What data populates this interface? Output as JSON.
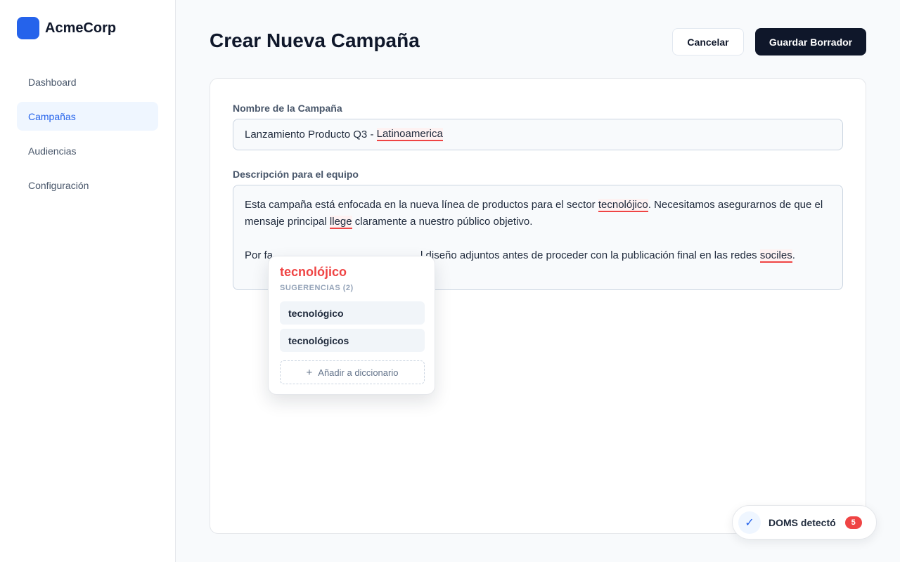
{
  "brand": {
    "name": "AcmeCorp"
  },
  "colors": {
    "accent": "#2563eb",
    "primary_dark": "#0f172a",
    "error": "#ef4444"
  },
  "nav": {
    "items": [
      {
        "label": "Dashboard",
        "active": false
      },
      {
        "label": "Campañas",
        "active": true
      },
      {
        "label": "Audiencias",
        "active": false
      },
      {
        "label": "Configuración",
        "active": false
      }
    ]
  },
  "header": {
    "title": "Crear Nueva Campaña",
    "cancel_label": "Cancelar",
    "save_label": "Guardar Borrador"
  },
  "form": {
    "name_label": "Nombre de la Campaña",
    "name_value_prefix": "Lanzamiento Producto Q3 - ",
    "name_value_error": "Latinoamerica",
    "desc_label": "Descripción para el equipo",
    "desc_p1": {
      "t1": "Esta campaña está enfocada en la nueva línea de productos para el sector ",
      "e1": "tecnolójico",
      "t2": ". Necesitamos asegurarnos de que el mensaje principal ",
      "e2": "llege",
      "t3": " claramente a nuestro público objetivo."
    },
    "desc_p2": {
      "t1": "Por fa",
      "hidden_error_placeholder": "",
      "t2": "l diseño adjuntos antes de proceder con la publicación final en las redes ",
      "e1": "sociles",
      "t3": "."
    }
  },
  "spellcheck": {
    "word": "tecnolójico",
    "suggestions_header": "SUGERENCIAS (2)",
    "suggestions": [
      "tecnológico",
      "tecnológicos"
    ],
    "add_label": "Añadir a diccionario"
  },
  "toast": {
    "text": "DOMS detectó",
    "count": "5"
  }
}
